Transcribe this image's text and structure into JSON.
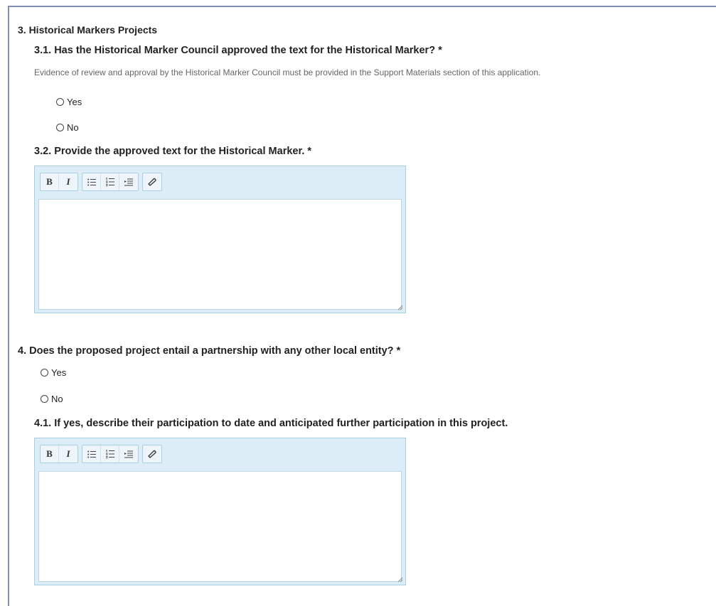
{
  "section3": {
    "title": "3. Historical Markers Projects",
    "q31": {
      "label": "3.1. Has the Historical Marker Council approved the text for the Historical Marker? *",
      "helper": "Evidence of review and approval by the Historical Marker Council must be provided in the Support Materials section of this application.",
      "options": [
        "Yes",
        "No"
      ]
    },
    "q32": {
      "label": "3.2. Provide the approved text for the Historical Marker. *",
      "value": ""
    }
  },
  "section4": {
    "title": "4. Does the proposed project entail a partnership with any other local entity? *",
    "options": [
      "Yes",
      "No"
    ],
    "q41": {
      "label": "4.1. If yes, describe their participation to date and anticipated further participation in this project.",
      "value": ""
    }
  },
  "toolbar": {
    "bold": "B",
    "italic": "I",
    "icons": [
      "bold-icon",
      "italic-icon",
      "bullet-list-icon",
      "numbered-list-icon",
      "indent-icon",
      "eraser-icon"
    ]
  },
  "colors": {
    "editor_bg": "#dcedf7",
    "editor_border": "#a9cfe3",
    "frame_border": "#7f8fb3"
  }
}
